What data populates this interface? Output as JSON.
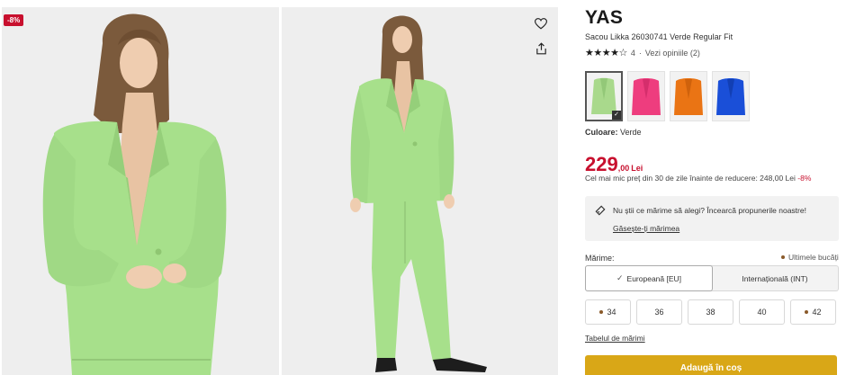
{
  "gallery": {
    "discount_badge": "-8%",
    "favorite_icon": "heart-icon",
    "share_icon": "share-icon"
  },
  "product": {
    "brand": "YAS",
    "name": "Sacou Likka 26030741 Verde Regular Fit",
    "rating_value": 4,
    "rating_max": 5,
    "rating_text": "4",
    "reviews_link": "Vezi opiniile (2)",
    "colors": [
      {
        "name": "Verde",
        "hex": "#a9d98c",
        "selected": true
      },
      {
        "name": "Roz",
        "hex": "#ee3d7e",
        "selected": false
      },
      {
        "name": "Portocaliu",
        "hex": "#ea7414",
        "selected": false
      },
      {
        "name": "Albastru",
        "hex": "#1a4fd8",
        "selected": false
      }
    ],
    "color_label": "Culoare:",
    "color_value": "Verde"
  },
  "price": {
    "integer": "229",
    "decimal": ",00",
    "currency": "Lei",
    "lowest_text": "Cel mai mic preț din 30 de zile înainte de reducere: 248,00 Lei",
    "lowest_pct": "-8%"
  },
  "size_help": {
    "question": "Nu știi ce mărime să alegi? Încearcă propunerile noastre!",
    "link": "Găsește-ți mărimea"
  },
  "sizes": {
    "label": "Mărime:",
    "last_items": "Ultimele bucăți",
    "systems": [
      {
        "label": "Europeană [EU]",
        "active": true
      },
      {
        "label": "Internațională (INT)",
        "active": false
      }
    ],
    "options": [
      {
        "label": "34",
        "low_stock": true
      },
      {
        "label": "36",
        "low_stock": false
      },
      {
        "label": "38",
        "low_stock": false
      },
      {
        "label": "40",
        "low_stock": false
      },
      {
        "label": "42",
        "low_stock": true
      }
    ],
    "table_link": "Tabelul de mărimi"
  },
  "cart": {
    "add_label": "Adaugă în coș"
  },
  "colors": {
    "accent_red": "#c8102e",
    "cta_yellow": "#d9a717",
    "blazer_green": "#a9d98c"
  }
}
